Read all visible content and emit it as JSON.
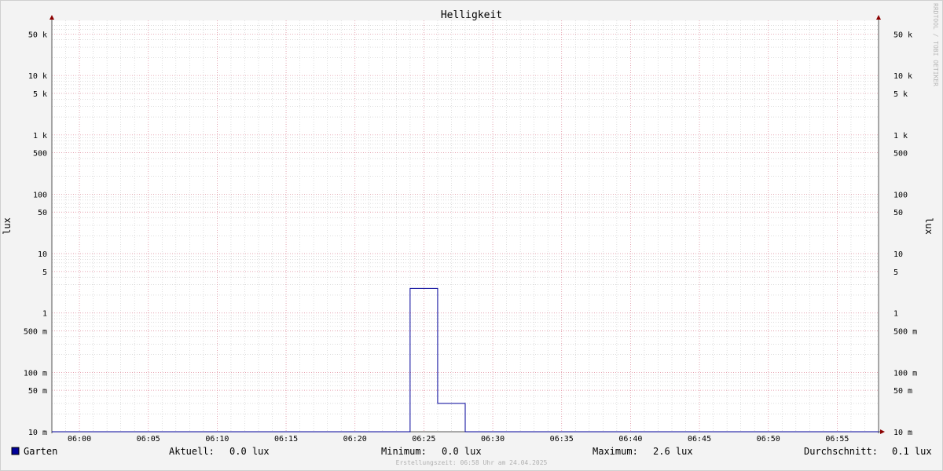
{
  "colors": {
    "background": "#f3f3f3",
    "canvas": "#ffffff",
    "axis": "#555555",
    "arrow": "#8b0000",
    "major_grid": "#e38a9c",
    "minor_grid": "#c8c8c8",
    "series": "#000099",
    "footer_text": "#b0b0b0"
  },
  "watermark": "RRDTOOL / TOBI OETIKER",
  "footer": "Erstellungszeit: 06:58 Uhr am 24.04.2025",
  "legend": {
    "series_name": "Garten",
    "stats": [
      {
        "label": "Aktuell:",
        "value": "0.0 lux"
      },
      {
        "label": "Minimum:",
        "value": "0.0 lux"
      },
      {
        "label": "Maximum:",
        "value": "2.6 lux"
      },
      {
        "label": "Durchschnitt:",
        "value": "0.1 lux"
      }
    ]
  },
  "chart_data": {
    "type": "line",
    "title": "Helligkeit",
    "ylabel": "lux",
    "yscale": "log",
    "ylim": [
      0.01,
      75000
    ],
    "xlim": [
      "05:58",
      "06:58"
    ],
    "grid": true,
    "x_ticks": [
      "06:00",
      "06:05",
      "06:10",
      "06:15",
      "06:20",
      "06:25",
      "06:30",
      "06:35",
      "06:40",
      "06:45",
      "06:50",
      "06:55"
    ],
    "y_ticks": [
      {
        "value": 0.01,
        "label": "10 m"
      },
      {
        "value": 0.05,
        "label": "50 m"
      },
      {
        "value": 0.1,
        "label": "100 m"
      },
      {
        "value": 0.5,
        "label": "500 m"
      },
      {
        "value": 1,
        "label": "1"
      },
      {
        "value": 5,
        "label": "5"
      },
      {
        "value": 10,
        "label": "10"
      },
      {
        "value": 50,
        "label": "50"
      },
      {
        "value": 100,
        "label": "100"
      },
      {
        "value": 500,
        "label": "500"
      },
      {
        "value": 1000,
        "label": "1 k"
      },
      {
        "value": 5000,
        "label": "5 k"
      },
      {
        "value": 10000,
        "label": "10 k"
      },
      {
        "value": 50000,
        "label": "50 k"
      }
    ],
    "series": [
      {
        "name": "Garten",
        "step": true,
        "x": [
          "05:58",
          "06:24",
          "06:26",
          "06:28",
          "06:58"
        ],
        "y": [
          0.0,
          2.6,
          0.03,
          0.0,
          0.0
        ]
      }
    ]
  }
}
